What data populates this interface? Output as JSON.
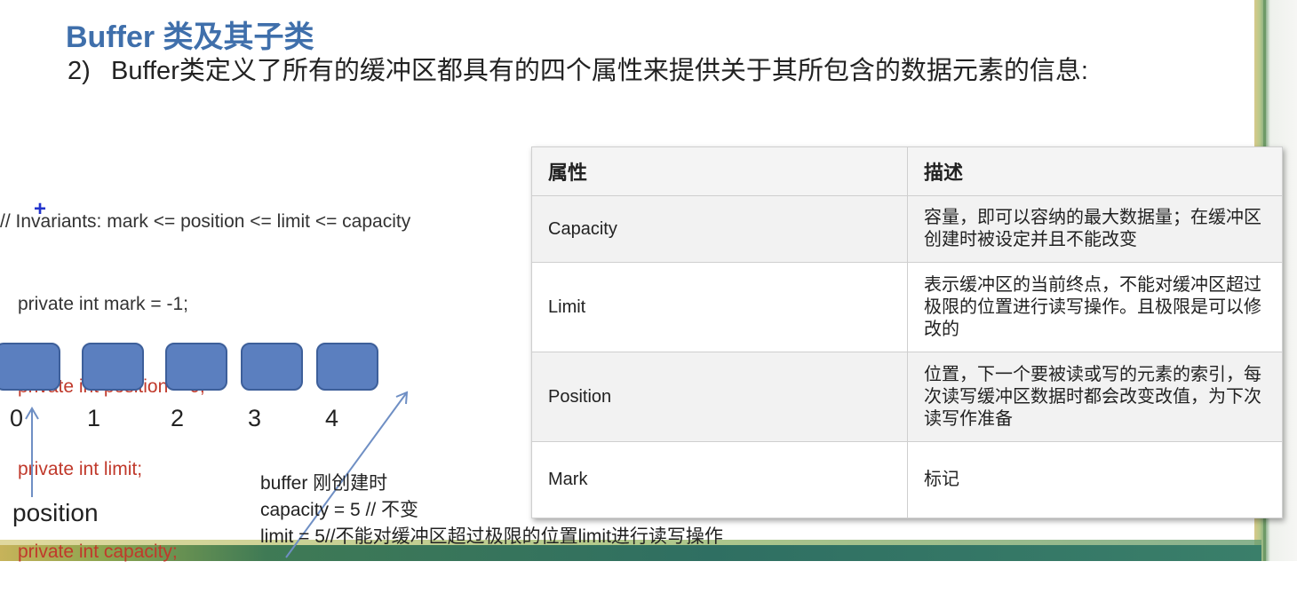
{
  "slide": {
    "title": "Buffer 类及其子类",
    "point_number": "2)",
    "point_text": "Buffer类定义了所有的缓冲区都具有的四个属性来提供关于其所包含的数据元素的信息:"
  },
  "code": {
    "lines": [
      "// Invariants: mark <= position <= limit <= capacity",
      "private int mark = -1;",
      "private int position = 0;",
      "private int limit;",
      "private int capacity;"
    ]
  },
  "diagram": {
    "indices": [
      "0",
      "1",
      "2",
      "3",
      "4"
    ],
    "position_label": "position",
    "note_lines": [
      "buffer 刚创建时",
      "capacity = 5 // 不变",
      "limit = 5//不能对缓冲区超过极限的位置limit进行读写操作"
    ],
    "colors": {
      "cell_fill": "#5b7fbf",
      "cell_border": "#3d5f9a",
      "arrow": "#6f8fc4"
    }
  },
  "table": {
    "headers": [
      "属性",
      "描述"
    ],
    "rows": [
      {
        "name": "Capacity",
        "desc": "容量，即可以容纳的最大数据量；在缓冲区创建时被设定并且不能改变"
      },
      {
        "name": "Limit",
        "desc": "表示缓冲区的当前终点，不能对缓冲区超过极限的位置进行读写操作。且极限是可以修改的"
      },
      {
        "name": "Position",
        "desc": "位置，下一个要被读或写的元素的索引，每次读写缓冲区数据时都会改变改值，为下次读写作准备"
      },
      {
        "name": "Mark",
        "desc": "标记"
      }
    ]
  },
  "theme": {
    "title_color": "#3f6fab",
    "code_red": "#c0392b"
  }
}
